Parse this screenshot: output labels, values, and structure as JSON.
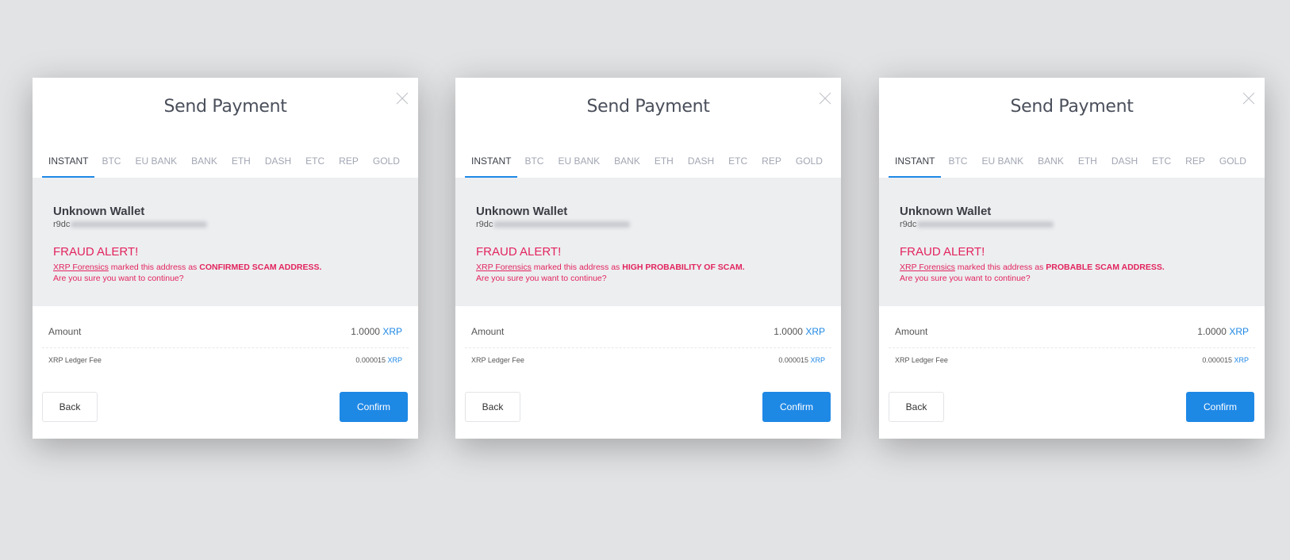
{
  "colors": {
    "background": "#e2e3e5",
    "alert_panel": "#edeef0",
    "alert_red": "#e2245e",
    "accent_blue": "#1e88e5"
  },
  "modals": [
    {
      "title": "Send Payment",
      "tabs": [
        "INSTANT",
        "BTC",
        "EU BANK",
        "BANK",
        "ETH",
        "DASH",
        "ETC",
        "REP",
        "GOLD"
      ],
      "active_tab": "INSTANT",
      "wallet_name": "Unknown Wallet",
      "address_prefix": "r9dc",
      "fraud_title": "FRAUD ALERT!",
      "fraud_source": "XRP Forensics",
      "fraud_mid": " marked this address as ",
      "fraud_status": "CONFIRMED SCAM ADDRESS.",
      "fraud_question": "Are you sure you want to continue?",
      "amount_label": "Amount",
      "amount_value": "1.0000",
      "amount_currency": "XRP",
      "fee_label": "XRP Ledger Fee",
      "fee_value": "0.000015",
      "fee_currency": "XRP",
      "back_label": "Back",
      "confirm_label": "Confirm"
    },
    {
      "title": "Send Payment",
      "tabs": [
        "INSTANT",
        "BTC",
        "EU BANK",
        "BANK",
        "ETH",
        "DASH",
        "ETC",
        "REP",
        "GOLD"
      ],
      "active_tab": "INSTANT",
      "wallet_name": "Unknown Wallet",
      "address_prefix": "r9dc",
      "fraud_title": "FRAUD ALERT!",
      "fraud_source": "XRP Forensics",
      "fraud_mid": " marked this address as ",
      "fraud_status": "HIGH PROBABILITY OF SCAM.",
      "fraud_question": "Are you sure you want to continue?",
      "amount_label": "Amount",
      "amount_value": "1.0000",
      "amount_currency": "XRP",
      "fee_label": "XRP Ledger Fee",
      "fee_value": "0.000015",
      "fee_currency": "XRP",
      "back_label": "Back",
      "confirm_label": "Confirm"
    },
    {
      "title": "Send Payment",
      "tabs": [
        "INSTANT",
        "BTC",
        "EU BANK",
        "BANK",
        "ETH",
        "DASH",
        "ETC",
        "REP",
        "GOLD"
      ],
      "active_tab": "INSTANT",
      "wallet_name": "Unknown Wallet",
      "address_prefix": "r9dc",
      "fraud_title": "FRAUD ALERT!",
      "fraud_source": "XRP Forensics",
      "fraud_mid": " marked this address as ",
      "fraud_status": "PROBABLE SCAM ADDRESS.",
      "fraud_question": "Are you sure you want to continue?",
      "amount_label": "Amount",
      "amount_value": "1.0000",
      "amount_currency": "XRP",
      "fee_label": "XRP Ledger Fee",
      "fee_value": "0.000015",
      "fee_currency": "XRP",
      "back_label": "Back",
      "confirm_label": "Confirm"
    }
  ]
}
